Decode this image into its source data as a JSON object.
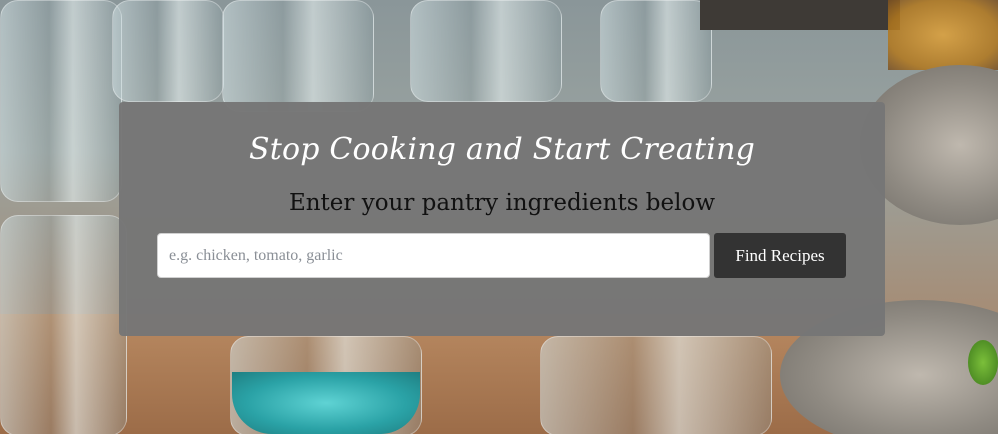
{
  "hero": {
    "headline": "Stop Cooking and Start Creating",
    "subheadline": "Enter your pantry ingredients below"
  },
  "search": {
    "placeholder": "e.g. chicken, tomato, garlic",
    "value": "",
    "button_label": "Find Recipes"
  },
  "colors": {
    "panel": "#767676",
    "button": "#333333",
    "headline": "#ffffff",
    "subheadline": "#111111"
  }
}
